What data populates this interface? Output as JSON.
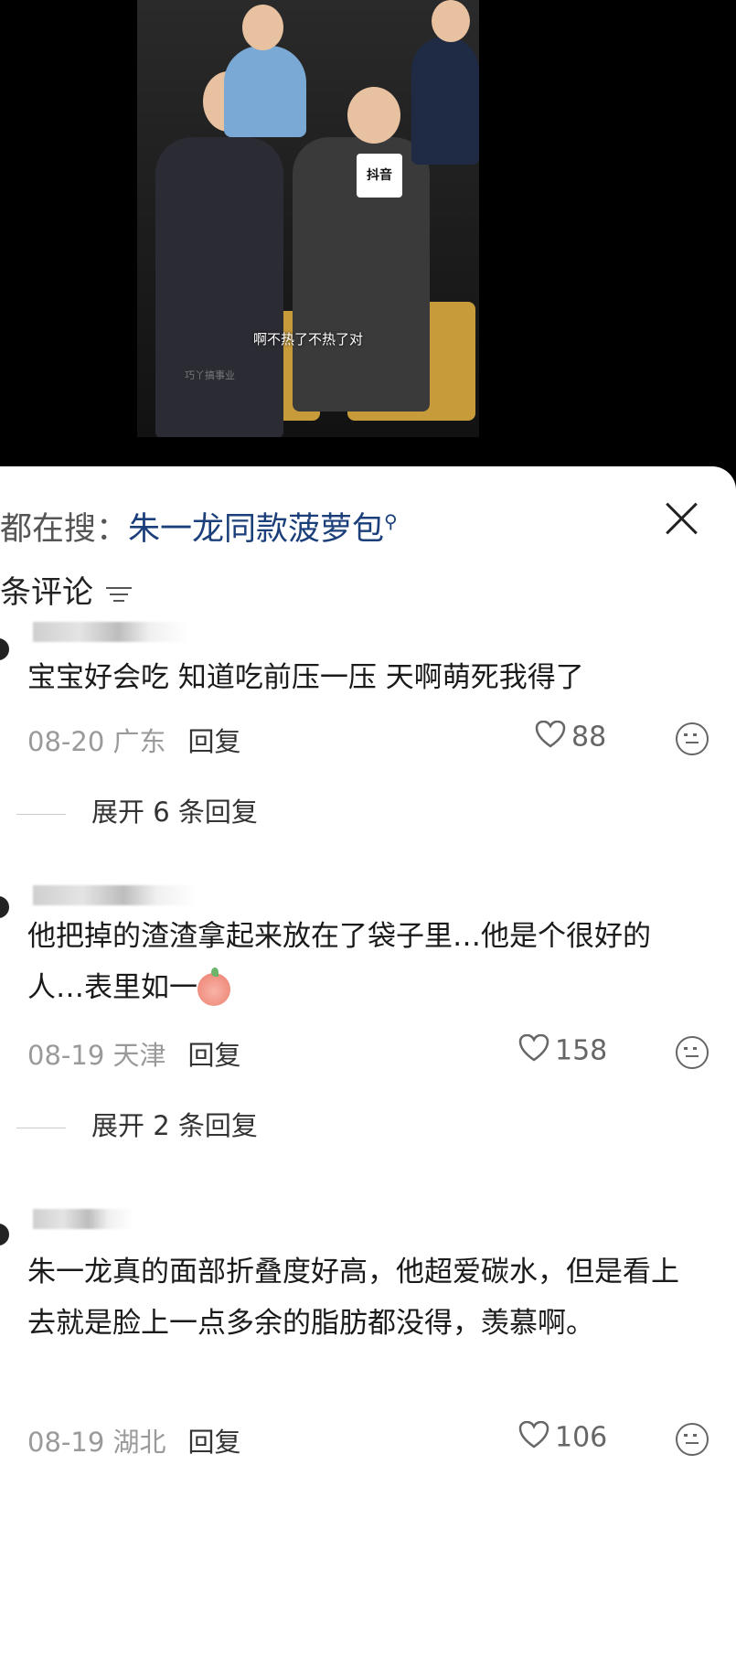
{
  "video": {
    "subtitle": "啊不热了不热了对",
    "watermark": "巧丫搞事业",
    "logo": "抖音"
  },
  "search": {
    "prefix": "都在搜：",
    "keyword": "朱一龙同款菠萝包"
  },
  "comments_header": {
    "label": "条评论"
  },
  "comments": [
    {
      "text": "宝宝好会吃 知道吃前压一压 天啊萌死我得了",
      "date_location": "08-20 广东",
      "reply_label": "回复",
      "likes": "88",
      "expand_label": "展开 6 条回复"
    },
    {
      "text": "他把掉的渣渣拿起来放在了袋子里…他是个很好的人…表里如一",
      "date_location": "08-19 天津",
      "reply_label": "回复",
      "likes": "158",
      "expand_label": "展开 2 条回复"
    },
    {
      "text": "朱一龙真的面部折叠度好高，他超爱碳水，但是看上去就是脸上一点多余的脂肪都没得，羡慕啊。",
      "date_location": "08-19 湖北",
      "reply_label": "回复",
      "likes": "106"
    }
  ]
}
